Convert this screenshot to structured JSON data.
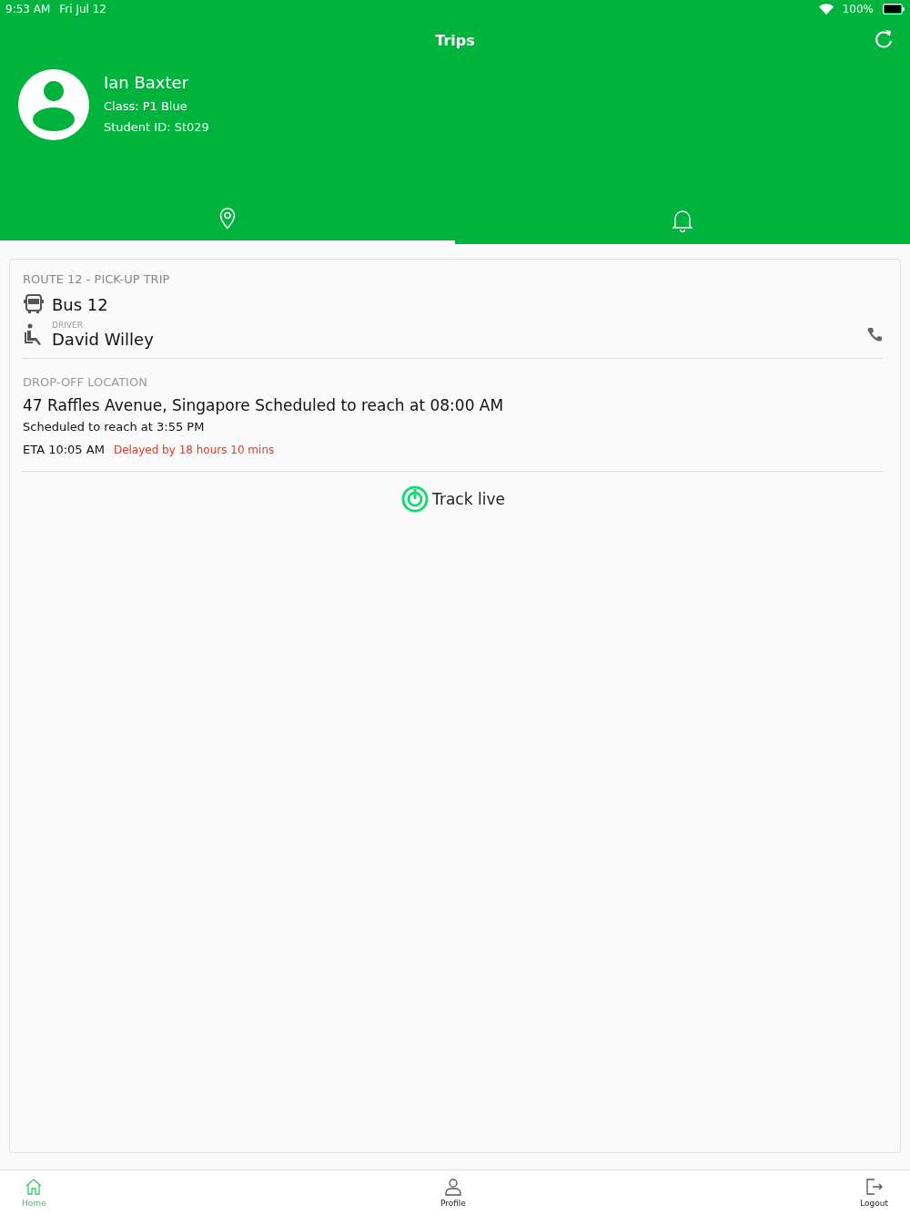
{
  "status_bar": {
    "time": "9:53 AM",
    "date": "Fri Jul 12",
    "battery": "100%"
  },
  "header": {
    "title": "Trips"
  },
  "profile": {
    "name": "Ian Baxter",
    "class": "Class: P1 Blue",
    "student_id": "Student ID: St029"
  },
  "tabs": [
    {
      "kind": "location",
      "selected": true
    },
    {
      "kind": "bell",
      "selected": false
    }
  ],
  "trip": {
    "route": "ROUTE 12 - PICK-UP TRIP",
    "bus": "Bus 12",
    "driver_label": "DRIVER",
    "driver": "David Willey",
    "dropoff_label": "DROP-OFF LOCATION",
    "address": "47 Raffles Avenue, Singapore Scheduled to reach at 08:00 AM",
    "scheduled": "Scheduled to reach at 3:55 PM",
    "eta": "ETA 10:05 AM",
    "delay": "Delayed by 18 hours 10 mins",
    "track": "Track live"
  },
  "bottom_nav": [
    {
      "kind": "home",
      "label": "Home",
      "selected": true
    },
    {
      "kind": "profile",
      "label": "Profile",
      "selected": false
    },
    {
      "kind": "logout",
      "label": "Logout",
      "selected": false
    }
  ]
}
